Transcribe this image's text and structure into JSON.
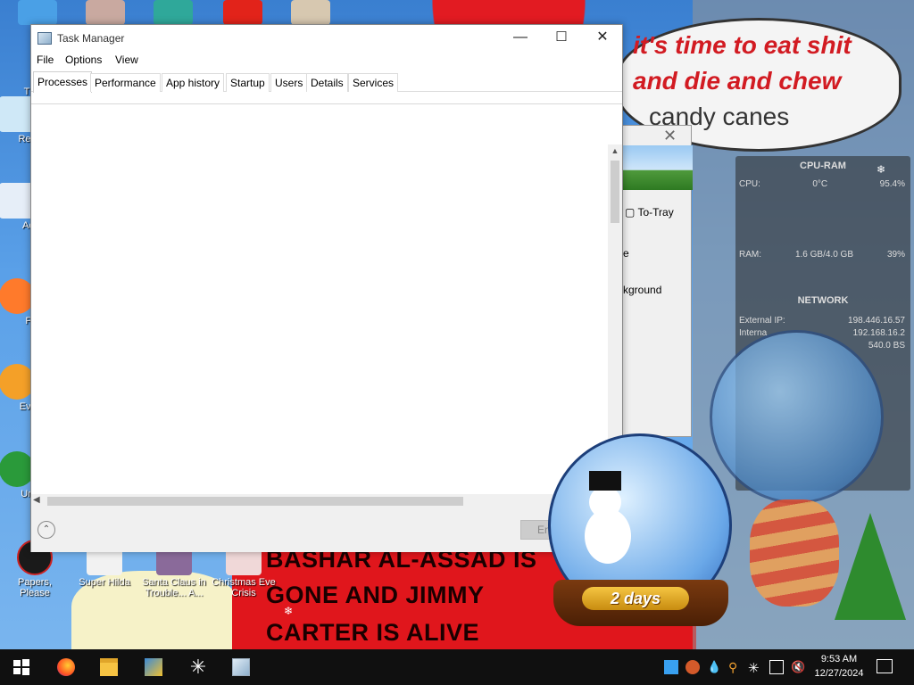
{
  "window": {
    "title": "Task Manager",
    "controls": {
      "minimize": "—",
      "maximize": "☐",
      "close": "✕"
    }
  },
  "menu": [
    "File",
    "Options",
    "View"
  ],
  "tabs": [
    {
      "label": "Processes",
      "active": true
    },
    {
      "label": "Performance",
      "active": false
    },
    {
      "label": "App history",
      "active": false
    },
    {
      "label": "Startup",
      "active": false
    },
    {
      "label": "Users",
      "active": false
    },
    {
      "label": "Details",
      "active": false
    },
    {
      "label": "Services",
      "active": false
    }
  ],
  "footer": {
    "end_task_label": "En",
    "fewer_details_glyph": "⌃"
  },
  "background_window": {
    "tray_label": "To-Tray",
    "fragment_e": "e",
    "fragment_background": "kground"
  },
  "desktop": {
    "speech_lines": [
      "it's time to eat shit",
      "and die and chew",
      "candy canes"
    ],
    "banner_lines": [
      "BASHAR AL-ASSAD IS",
      "GONE AND JIMMY",
      "CARTER IS ALIVE"
    ],
    "globe_badge": "2 days",
    "icons": [
      {
        "label": "Th"
      },
      {
        "label": "Recy"
      },
      {
        "label": "Act"
      },
      {
        "label": "Fi"
      },
      {
        "label": "Ever"
      },
      {
        "label": "Unc"
      },
      {
        "label": "Papers, Please"
      },
      {
        "label": "Super Hilda"
      },
      {
        "label": "Santa Claus in Trouble... A..."
      },
      {
        "label": "Christmas Eve Crisis"
      }
    ],
    "gadget": {
      "title": "CPU-RAM",
      "cpu_label": "CPU:",
      "cpu_temp": "0°C",
      "cpu_value": "95.4%",
      "ram_label": "RAM:",
      "ram_usage": "1.6 GB/4.0 GB",
      "ram_percent": "39%",
      "network_title": "NETWORK",
      "external_ip_label": "External IP:",
      "external_ip": "198.446.16.57",
      "internal_ip_label": "Interna",
      "internal_ip": "192.168.16.2",
      "received": "540.0 BS"
    }
  },
  "taskbar": {
    "clock_time": "9:53 AM",
    "clock_date": "12/27/2024"
  },
  "colors": {
    "taskbar": "#101010",
    "banner_red": "#e0161c",
    "window_bg": "#ffffff",
    "footer_bg": "#f0f0f0",
    "end_task_disabled": "#cccccc"
  }
}
